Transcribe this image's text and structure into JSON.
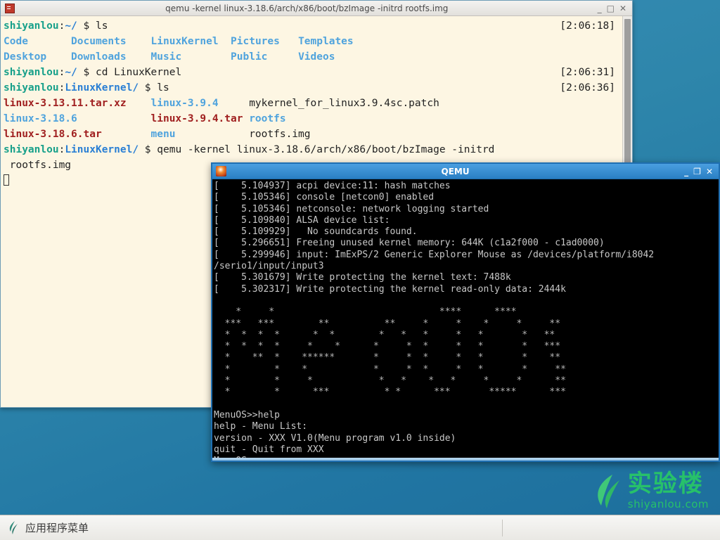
{
  "desktop": {
    "background_color": "#2e86ab",
    "watermark": {
      "cn": "实验楼",
      "en": "shiyanlou.com",
      "color": "#27c16a",
      "logo_icon": "leaf-logo-icon"
    }
  },
  "terminal_window": {
    "title": "qemu -kernel linux-3.18.6/arch/x86/boot/bzImage -initrd rootfs.img",
    "icon": "terminal-icon",
    "minimize_label": "_",
    "maximize_label": "□",
    "close_label": "✕",
    "lines": [
      {
        "type": "prompt",
        "host": "shiyanlou",
        "colon": ":",
        "path": "~/",
        "dollar": "$",
        "command": "ls",
        "stamp": "[2:06:18]"
      },
      {
        "type": "cols",
        "cells": [
          {
            "text": "Code",
            "color": "dir"
          },
          {
            "text": "Documents",
            "color": "dir"
          },
          {
            "text": "LinuxKernel",
            "color": "dir"
          },
          {
            "text": "Pictures",
            "color": "dir"
          },
          {
            "text": "Templates",
            "color": "dir"
          }
        ]
      },
      {
        "type": "cols",
        "cells": [
          {
            "text": "Desktop",
            "color": "dir"
          },
          {
            "text": "Downloads",
            "color": "dir"
          },
          {
            "text": "Music",
            "color": "dir"
          },
          {
            "text": "Public",
            "color": "dir"
          },
          {
            "text": "Videos",
            "color": "dir"
          }
        ]
      },
      {
        "type": "prompt",
        "host": "shiyanlou",
        "colon": ":",
        "path": "~/",
        "dollar": "$",
        "command": "cd LinuxKernel",
        "stamp": "[2:06:31]"
      },
      {
        "type": "prompt",
        "host": "shiyanlou",
        "colon": ":",
        "path": "LinuxKernel/",
        "dollar": "$",
        "command": "ls",
        "stamp": "[2:06:36]"
      },
      {
        "type": "cols3",
        "cells": [
          {
            "text": "linux-3.13.11.tar.xz",
            "color": "arch"
          },
          {
            "text": "linux-3.9.4",
            "color": "dir"
          },
          {
            "text": "mykernel_for_linux3.9.4sc.patch",
            "color": "file"
          }
        ]
      },
      {
        "type": "cols3",
        "cells": [
          {
            "text": "linux-3.18.6",
            "color": "dir"
          },
          {
            "text": "linux-3.9.4.tar",
            "color": "arch"
          },
          {
            "text": "rootfs",
            "color": "dir"
          }
        ]
      },
      {
        "type": "cols3",
        "cells": [
          {
            "text": "linux-3.18.6.tar",
            "color": "arch"
          },
          {
            "text": "menu",
            "color": "dir"
          },
          {
            "text": "rootfs.img",
            "color": "file"
          }
        ]
      },
      {
        "type": "prompt",
        "host": "shiyanlou",
        "colon": ":",
        "path": "LinuxKernel/",
        "dollar": "$",
        "command": "qemu -kernel linux-3.18.6/arch/x86/boot/bzImage -initrd",
        "stamp": ""
      },
      {
        "type": "plain",
        "text": " rootfs.img"
      }
    ],
    "scrollbar": "vertical-scrollbar"
  },
  "qemu_window": {
    "title": "QEMU",
    "icon": "qemu-logo-icon",
    "minimize_label": "_",
    "maximize_label": "❐",
    "close_label": "✕",
    "boot_log": [
      "[    5.104937] acpi device:11: hash matches",
      "[    5.105346] console [netcon0] enabled",
      "[    5.105346] netconsole: network logging started",
      "[    5.109840] ALSA device list:",
      "[    5.109929]   No soundcards found.",
      "[    5.296651] Freeing unused kernel memory: 644K (c1a2f000 - c1ad0000)",
      "[    5.299946] input: ImExPS/2 Generic Explorer Mouse as /devices/platform/i8042",
      "/serio1/input/input3",
      "[    5.301679] Write protecting the kernel text: 7488k",
      "[    5.302317] Write protecting the kernel read-only data: 2444k"
    ],
    "ascii_banner": [
      "    *     *                              ****      ****",
      "  ***   ***        **          **     *     *    *     *     **",
      "  *  *  *  *      *  *        *   *   *     *   *       *   **",
      "  *  *  *  *     *    *      *     *  *     *   *       *   ***",
      "  *    **  *    ******       *     *  *     *   *       *    **",
      "  *        *    *            *     *  *     *   *       *     **",
      "  *        *     *            *   *    *   *     *     *      **",
      "  *        *      ***          * *      ***       *****      ***"
    ],
    "shell": [
      "MenuOS>>help",
      "help - Menu List:",
      "version - XXX V1.0(Menu program v1.0 inside)",
      "quit - Quit from XXX"
    ],
    "prompt": "MenuOS>>"
  },
  "taskbar": {
    "app_menu_label": "应用程序菜单",
    "app_menu_icon": "xfce-mouse-icon"
  }
}
